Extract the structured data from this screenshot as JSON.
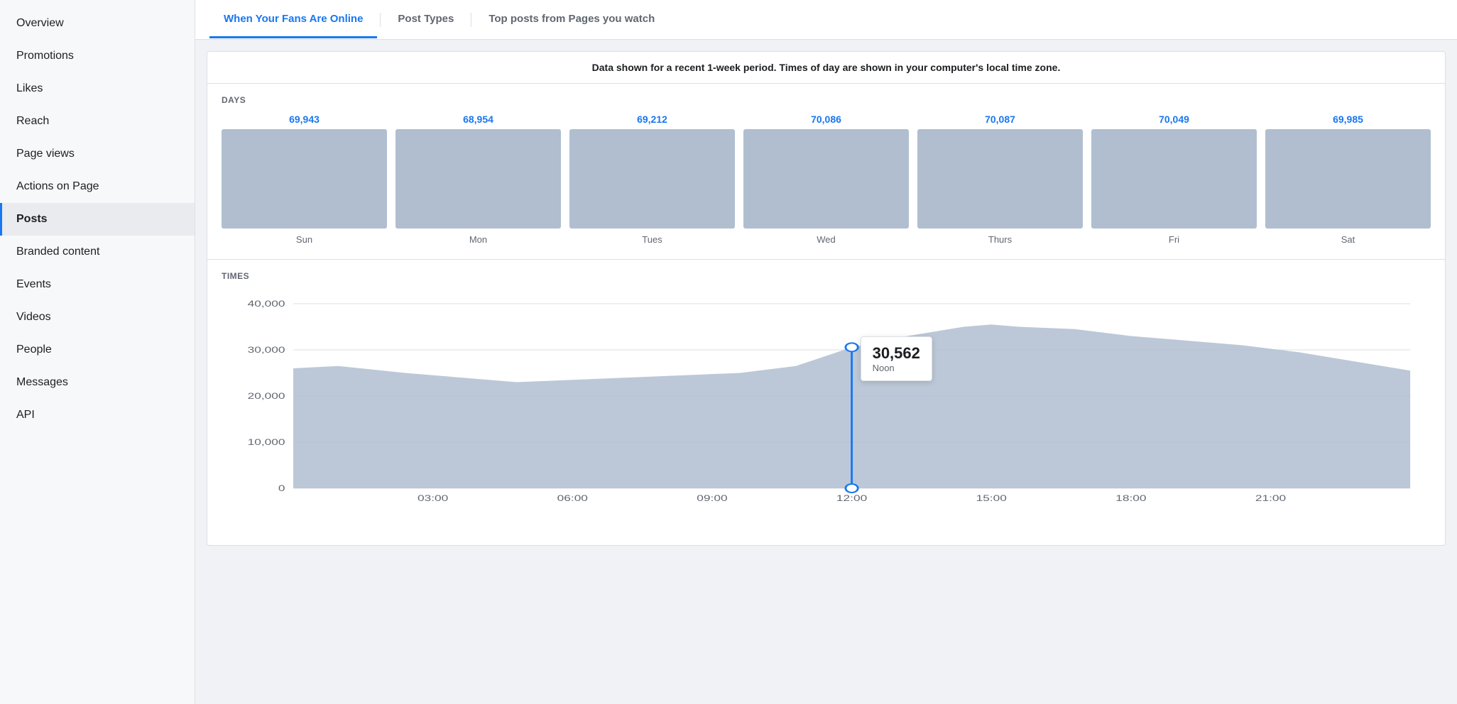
{
  "sidebar": {
    "items": [
      {
        "id": "overview",
        "label": "Overview",
        "active": false
      },
      {
        "id": "promotions",
        "label": "Promotions",
        "active": false
      },
      {
        "id": "likes",
        "label": "Likes",
        "active": false
      },
      {
        "id": "reach",
        "label": "Reach",
        "active": false
      },
      {
        "id": "page-views",
        "label": "Page views",
        "active": false
      },
      {
        "id": "actions-on-page",
        "label": "Actions on Page",
        "active": false
      },
      {
        "id": "posts",
        "label": "Posts",
        "active": true
      },
      {
        "id": "branded-content",
        "label": "Branded content",
        "active": false
      },
      {
        "id": "events",
        "label": "Events",
        "active": false
      },
      {
        "id": "videos",
        "label": "Videos",
        "active": false
      },
      {
        "id": "people",
        "label": "People",
        "active": false
      },
      {
        "id": "messages",
        "label": "Messages",
        "active": false
      },
      {
        "id": "api",
        "label": "API",
        "active": false
      }
    ]
  },
  "tabs": [
    {
      "id": "when-fans-online",
      "label": "When Your Fans Are Online",
      "active": true
    },
    {
      "id": "post-types",
      "label": "Post Types",
      "active": false
    },
    {
      "id": "top-posts",
      "label": "Top posts from Pages you watch",
      "active": false
    }
  ],
  "info_banner": "Data shown for a recent 1-week period. Times of day are shown in your computer's local time zone.",
  "days_section": {
    "label": "DAYS",
    "days": [
      {
        "name": "Sun",
        "value": "69,943"
      },
      {
        "name": "Mon",
        "value": "68,954"
      },
      {
        "name": "Tues",
        "value": "69,212"
      },
      {
        "name": "Wed",
        "value": "70,086"
      },
      {
        "name": "Thurs",
        "value": "70,087"
      },
      {
        "name": "Fri",
        "value": "70,049"
      },
      {
        "name": "Sat",
        "value": "69,985"
      }
    ]
  },
  "times_section": {
    "label": "TIMES",
    "tooltip": {
      "value": "30,562",
      "label": "Noon"
    },
    "y_axis": [
      "40,000",
      "30,000",
      "20,000",
      "10,000",
      "0"
    ],
    "x_axis": [
      "03:00",
      "06:00",
      "09:00",
      "12:00",
      "15:00",
      "18:00",
      "21:00"
    ]
  }
}
